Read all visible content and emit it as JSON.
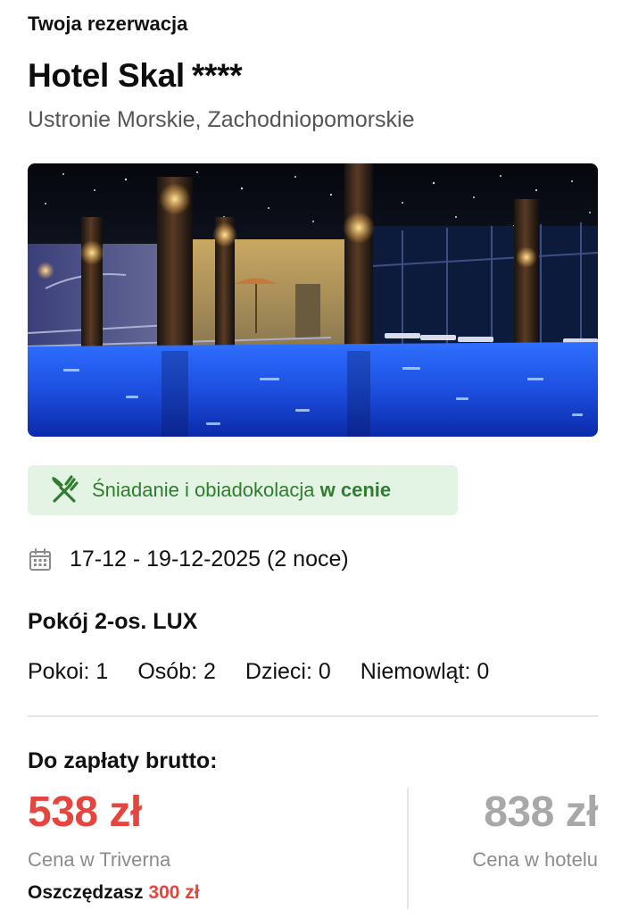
{
  "booking": {
    "heading": "Twoja rezerwacja",
    "hotel_name": "Hotel Skal",
    "stars": "****",
    "location": "Ustronie Morskie, Zachodniopomorskie"
  },
  "meal": {
    "icon": "fork-knife-icon",
    "text": "Śniadanie i obiadokolacja",
    "suffix": "w cenie",
    "colors": {
      "background": "#e4f4e4",
      "text": "#2f7d2f"
    }
  },
  "stay": {
    "icon": "calendar-icon",
    "dates": "17-12 - 19-12-2025 (2 noce)"
  },
  "room": {
    "name": "Pokój 2-os. LUX"
  },
  "guests": {
    "rooms": "Pokoi: 1",
    "adults": "Osób: 2",
    "children": "Dzieci: 0",
    "infants": "Niemowląt: 0"
  },
  "payment": {
    "label": "Do zapłaty brutto:",
    "price": "538 zł",
    "price_label": "Cena w Triverna",
    "hotel_price": "838 zł",
    "hotel_price_label": "Cena w hotelu",
    "savings_label": "Oszczędzasz",
    "savings_amount": "300 zł",
    "colors": {
      "accent": "#e5453e",
      "muted": "#a8a8a8"
    }
  }
}
